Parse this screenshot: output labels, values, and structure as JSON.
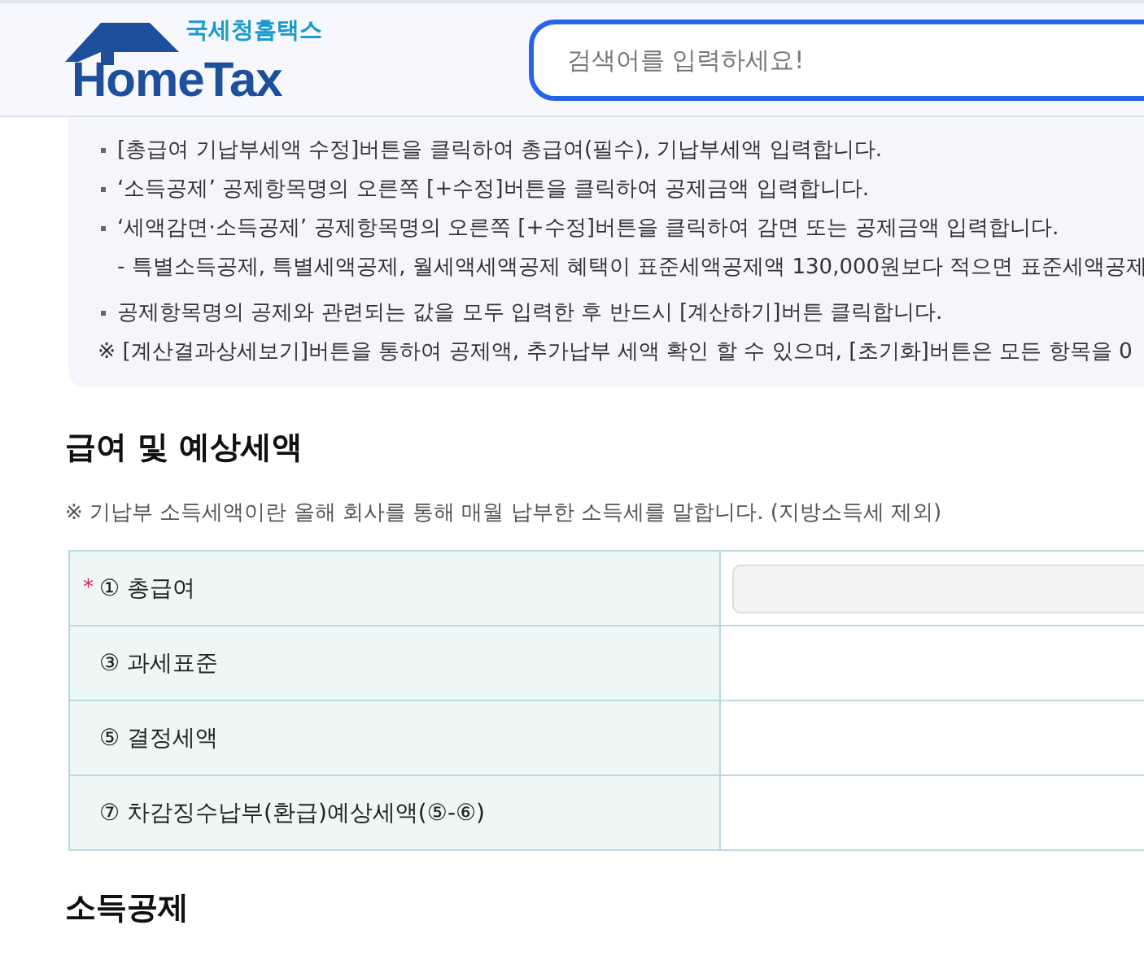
{
  "header": {
    "logo_subtitle": "국세청홈택스",
    "logo_title": "HomeTax",
    "search": {
      "placeholder": "검색어를 입력하세요!"
    }
  },
  "guide": [
    {
      "kind": "bullet",
      "text": "[총급여 기납부세액 수정]버튼을 클릭하여 총급여(필수), 기납부세액 입력합니다."
    },
    {
      "kind": "bullet",
      "text": "‘소득공제’ 공제항목명의 오른쪽 [+수정]버튼을 클릭하여 공제금액 입력합니다."
    },
    {
      "kind": "bullet",
      "text": "‘세액감면·소득공제’ 공제항목명의 오른쪽 [+수정]버튼을 클릭하여 감면 또는 공제금액 입력합니다."
    },
    {
      "kind": "sub",
      "text": "- 특별소득공제, 특별세액공제, 월세액세액공제 혜택이 표준세액공제액 130,000원보다 적으면 표준세액공제"
    },
    {
      "kind": "bullet",
      "text": "공제항목명의 공제와 관련되는 값을 모두 입력한 후 반드시 [계산하기]버튼 클릭합니다."
    },
    {
      "kind": "note",
      "text": "※ [계산결과상세보기]버튼을 통하여 공제액, 추가납부 세액 확인 할 수 있으며, [초기화]버튼은 모든 항목을 0"
    }
  ],
  "salary_section": {
    "title": "급여 및 예상세액",
    "required_mark": "*",
    "note": "※ 기납부 소득세액이란 올해 회사를 통해 매월 납부한 소득세를 말합니다. (지방소득세 제외)",
    "rows": [
      {
        "label": "① 총급여",
        "required": true,
        "kind": "input"
      },
      {
        "label": "③ 과세표준",
        "required": false,
        "kind": "value"
      },
      {
        "label": "⑤ 결정세액",
        "required": false,
        "kind": "value"
      },
      {
        "label": "⑦ 차감징수납부(환급)예상세액(⑤-⑥)",
        "required": false,
        "kind": "value"
      }
    ]
  },
  "next_section": {
    "title": "소득공제"
  }
}
